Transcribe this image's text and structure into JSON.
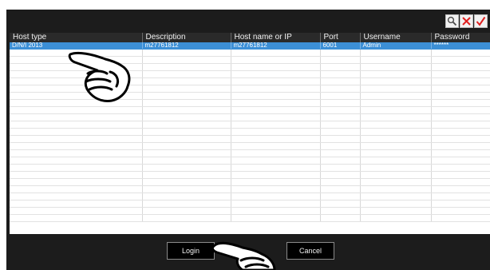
{
  "toolbar": {
    "icons": [
      "search-icon",
      "delete-icon",
      "confirm-icon"
    ],
    "colors": {
      "delete": "#e02020",
      "confirm": "#e02020"
    }
  },
  "table": {
    "columns": [
      "Host type",
      "Description",
      "Host name or IP",
      "Port",
      "Username",
      "Password"
    ],
    "rows": [
      [
        "D/N/I 2013",
        "m27761812",
        "m27761812",
        "6001",
        "Admin",
        "******"
      ]
    ],
    "empty_row_count": 24
  },
  "footer": {
    "login_label": "Login",
    "cancel_label": "Cancel"
  },
  "overlay": {
    "icons": [
      "pointing-hand-icon",
      "pointing-hand-icon"
    ]
  },
  "colors": {
    "dialog_background": "#1c1c1c",
    "header_background": "#2a2a2a",
    "selected_row": "#3c8fd6"
  }
}
